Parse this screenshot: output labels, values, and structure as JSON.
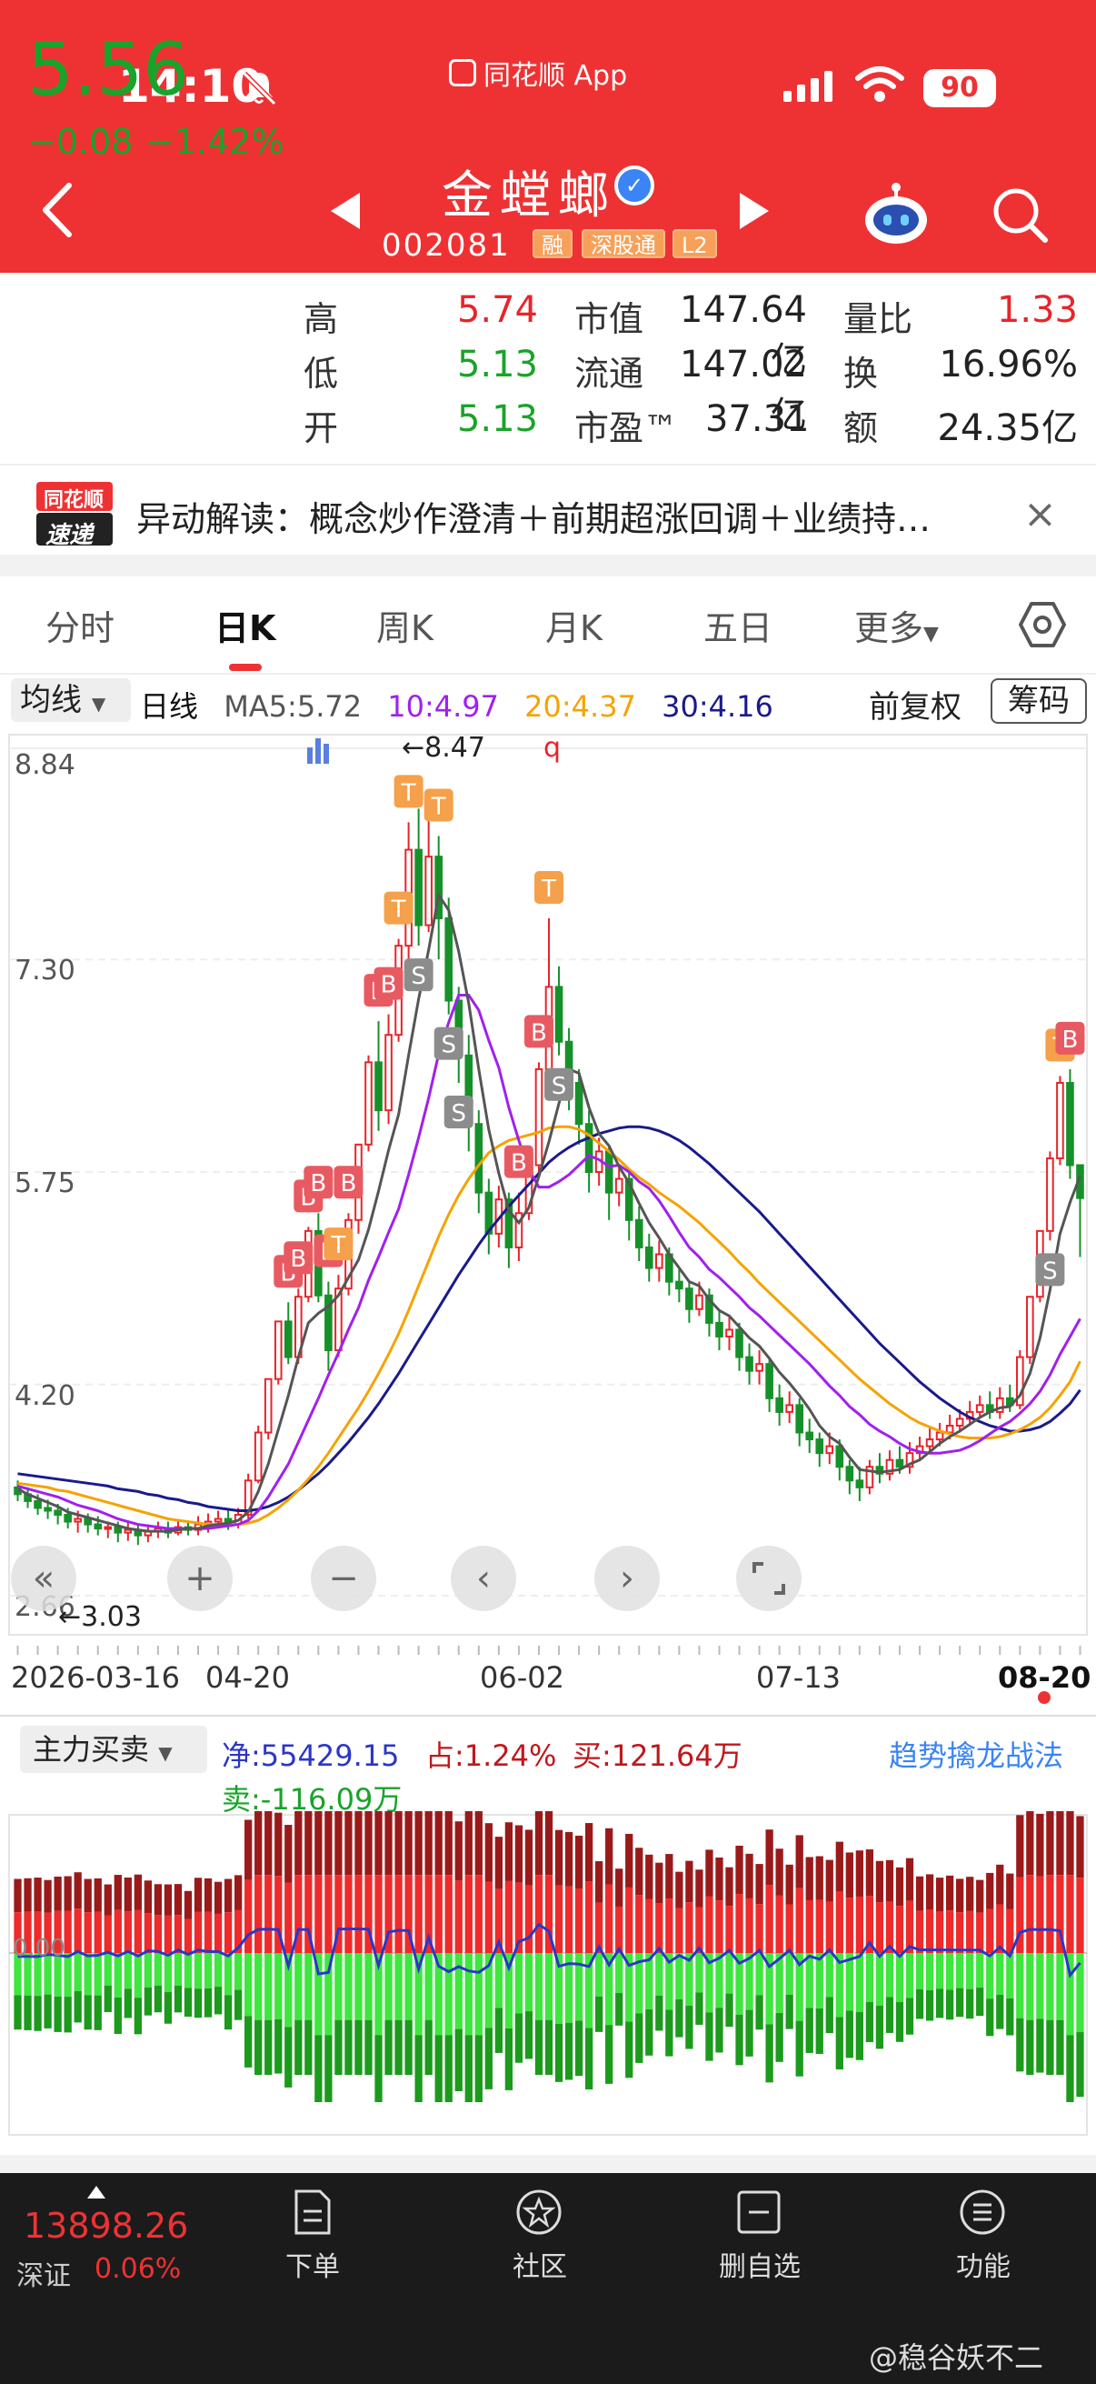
{
  "status": {
    "time": "14:10",
    "source_app": "同花顺 App",
    "battery": "90"
  },
  "stock": {
    "name": "金螳螂",
    "code": "002081",
    "tags": [
      "融",
      "深股通",
      "L2"
    ]
  },
  "quote": {
    "price": "5.56",
    "change": "−0.08",
    "change_pct": "−1.42%",
    "high_label": "高",
    "high": "5.74",
    "low_label": "低",
    "low": "5.13",
    "open_label": "开",
    "open": "5.13",
    "mktcap_label": "市值",
    "mktcap": "147.64亿",
    "float_label": "流通",
    "float": "147.02亿",
    "pe_label": "市盈™",
    "pe": "37.31",
    "vol_ratio_label": "量比",
    "vol_ratio": "1.33",
    "turnover_label": "换",
    "turnover": "16.96%",
    "amount_label": "额",
    "amount": "24.35亿"
  },
  "news": {
    "logo_line1": "同花顺",
    "logo_line2": "速递",
    "text": "异动解读：概念炒作澄清＋前期超涨回调＋业绩持…",
    "close": "×"
  },
  "tabs": [
    "分时",
    "日K",
    "周K",
    "月K",
    "五日",
    "更多"
  ],
  "ma": {
    "select": "均线",
    "period": "日线",
    "ma5": "MA5:5.72",
    "ma10": "10:4.97",
    "ma20": "20:4.37",
    "ma30": "30:4.16",
    "adjust": "前复权",
    "chips": "筹码",
    "colors": {
      "ma5": "#555555",
      "ma10": "#a020f0",
      "ma20": "#f5a300",
      "ma30": "#1a1a8c"
    }
  },
  "chart_data": {
    "type": "candlestick",
    "y_ticks": [
      "8.84",
      "7.30",
      "5.75",
      "4.20",
      "2.66"
    ],
    "ylim": [
      2.66,
      8.84
    ],
    "x_ticks": [
      "2026-03-16",
      "04-20",
      "06-02",
      "07-13",
      "08-20"
    ],
    "annotations": {
      "high_marker": "←8.47",
      "low_marker": "←3.03"
    },
    "marker_labels": {
      "buy": "B",
      "sell": "S",
      "t": "T",
      "q": "q"
    },
    "candles": [
      [
        3.45,
        3.4,
        3.5,
        3.35
      ],
      [
        3.4,
        3.35,
        3.45,
        3.3
      ],
      [
        3.35,
        3.3,
        3.4,
        3.25
      ],
      [
        3.3,
        3.28,
        3.36,
        3.22
      ],
      [
        3.28,
        3.25,
        3.33,
        3.18
      ],
      [
        3.25,
        3.2,
        3.3,
        3.15
      ],
      [
        3.2,
        3.22,
        3.28,
        3.12
      ],
      [
        3.22,
        3.18,
        3.26,
        3.12
      ],
      [
        3.18,
        3.15,
        3.24,
        3.1
      ],
      [
        3.15,
        3.16,
        3.2,
        3.08
      ],
      [
        3.16,
        3.12,
        3.2,
        3.05
      ],
      [
        3.12,
        3.14,
        3.2,
        3.06
      ],
      [
        3.14,
        3.1,
        3.18,
        3.03
      ],
      [
        3.1,
        3.13,
        3.18,
        3.05
      ],
      [
        3.13,
        3.15,
        3.2,
        3.08
      ],
      [
        3.15,
        3.12,
        3.2,
        3.08
      ],
      [
        3.12,
        3.16,
        3.22,
        3.1
      ],
      [
        3.16,
        3.14,
        3.2,
        3.1
      ],
      [
        3.14,
        3.18,
        3.24,
        3.1
      ],
      [
        3.18,
        3.2,
        3.26,
        3.12
      ],
      [
        3.2,
        3.22,
        3.28,
        3.15
      ],
      [
        3.22,
        3.18,
        3.28,
        3.14
      ],
      [
        3.18,
        3.25,
        3.3,
        3.15
      ],
      [
        3.25,
        3.5,
        3.55,
        3.22
      ],
      [
        3.5,
        3.85,
        3.9,
        3.48
      ],
      [
        3.85,
        4.24,
        4.24,
        3.8
      ],
      [
        4.24,
        4.66,
        4.66,
        4.2
      ],
      [
        4.66,
        4.4,
        4.8,
        4.35
      ],
      [
        4.4,
        4.84,
        4.9,
        4.35
      ],
      [
        4.84,
        5.32,
        5.35,
        4.8
      ],
      [
        5.32,
        4.85,
        5.45,
        4.8
      ],
      [
        4.85,
        4.45,
        4.95,
        4.3
      ],
      [
        4.45,
        4.9,
        5.0,
        4.4
      ],
      [
        4.9,
        5.4,
        5.45,
        4.85
      ],
      [
        5.4,
        5.95,
        5.95,
        5.3
      ],
      [
        5.95,
        6.55,
        6.6,
        5.9
      ],
      [
        6.55,
        6.2,
        6.85,
        6.05
      ],
      [
        6.2,
        6.75,
        6.9,
        6.1
      ],
      [
        6.75,
        7.4,
        7.45,
        6.7
      ],
      [
        7.4,
        8.1,
        8.3,
        7.3
      ],
      [
        8.1,
        7.55,
        8.4,
        7.4
      ],
      [
        7.55,
        8.05,
        8.47,
        7.5
      ],
      [
        8.05,
        7.6,
        8.2,
        7.3
      ],
      [
        7.6,
        7.0,
        7.75,
        6.9
      ],
      [
        7.0,
        6.6,
        7.1,
        6.4
      ],
      [
        6.6,
        6.1,
        6.75,
        5.9
      ],
      [
        6.1,
        5.6,
        6.2,
        5.45
      ],
      [
        5.6,
        5.3,
        5.7,
        5.15
      ],
      [
        5.3,
        5.55,
        5.65,
        5.2
      ],
      [
        5.55,
        5.2,
        5.6,
        5.05
      ],
      [
        5.2,
        5.45,
        5.6,
        5.1
      ],
      [
        5.45,
        5.8,
        5.9,
        5.4
      ],
      [
        5.8,
        6.5,
        6.55,
        5.75
      ],
      [
        6.5,
        7.1,
        7.6,
        6.4
      ],
      [
        7.1,
        6.7,
        7.25,
        6.6
      ],
      [
        6.7,
        6.4,
        6.8,
        6.2
      ],
      [
        6.4,
        6.1,
        6.5,
        5.95
      ],
      [
        6.1,
        5.75,
        6.2,
        5.6
      ],
      [
        5.75,
        5.9,
        6.0,
        5.65
      ],
      [
        5.9,
        5.6,
        5.95,
        5.4
      ],
      [
        5.6,
        5.7,
        5.8,
        5.5
      ],
      [
        5.7,
        5.4,
        5.75,
        5.25
      ],
      [
        5.4,
        5.2,
        5.5,
        5.1
      ],
      [
        5.2,
        5.05,
        5.3,
        4.95
      ],
      [
        5.05,
        5.15,
        5.25,
        4.95
      ],
      [
        5.15,
        4.95,
        5.2,
        4.85
      ],
      [
        4.95,
        4.9,
        5.05,
        4.8
      ],
      [
        4.9,
        4.75,
        4.95,
        4.65
      ],
      [
        4.75,
        4.85,
        4.95,
        4.7
      ],
      [
        4.85,
        4.65,
        4.9,
        4.55
      ],
      [
        4.65,
        4.55,
        4.75,
        4.45
      ],
      [
        4.55,
        4.6,
        4.7,
        4.45
      ],
      [
        4.6,
        4.4,
        4.65,
        4.3
      ],
      [
        4.4,
        4.3,
        4.5,
        4.2
      ],
      [
        4.3,
        4.35,
        4.45,
        4.2
      ],
      [
        4.35,
        4.1,
        4.4,
        4.0
      ],
      [
        4.1,
        4.0,
        4.2,
        3.9
      ],
      [
        4.0,
        4.05,
        4.15,
        3.92
      ],
      [
        4.05,
        3.85,
        4.1,
        3.75
      ],
      [
        3.85,
        3.8,
        3.95,
        3.7
      ],
      [
        3.8,
        3.7,
        3.85,
        3.6
      ],
      [
        3.7,
        3.75,
        3.85,
        3.62
      ],
      [
        3.75,
        3.6,
        3.8,
        3.5
      ],
      [
        3.6,
        3.5,
        3.65,
        3.4
      ],
      [
        3.5,
        3.45,
        3.6,
        3.35
      ],
      [
        3.45,
        3.6,
        3.65,
        3.4
      ],
      [
        3.6,
        3.55,
        3.7,
        3.48
      ],
      [
        3.55,
        3.65,
        3.72,
        3.5
      ],
      [
        3.65,
        3.6,
        3.75,
        3.55
      ],
      [
        3.6,
        3.7,
        3.78,
        3.55
      ],
      [
        3.7,
        3.75,
        3.82,
        3.65
      ],
      [
        3.75,
        3.8,
        3.88,
        3.7
      ],
      [
        3.8,
        3.85,
        3.92,
        3.75
      ],
      [
        3.85,
        3.9,
        3.98,
        3.8
      ],
      [
        3.9,
        3.95,
        4.02,
        3.85
      ],
      [
        3.95,
        4.0,
        4.08,
        3.9
      ],
      [
        4.0,
        4.05,
        4.12,
        3.95
      ],
      [
        4.05,
        4.0,
        4.15,
        3.95
      ],
      [
        4.0,
        4.1,
        4.18,
        3.95
      ],
      [
        4.1,
        4.05,
        4.2,
        4.0
      ],
      [
        4.05,
        4.4,
        4.45,
        4.02
      ],
      [
        4.4,
        4.84,
        4.84,
        4.35
      ],
      [
        4.84,
        5.32,
        5.32,
        4.8
      ],
      [
        5.32,
        5.85,
        5.9,
        5.25
      ],
      [
        5.85,
        6.4,
        6.45,
        5.8
      ],
      [
        6.4,
        5.8,
        6.5,
        5.7
      ],
      [
        5.8,
        5.56,
        5.74,
        5.13
      ]
    ],
    "ma5": [
      3.44,
      3.4,
      3.37,
      3.34,
      3.31,
      3.27,
      3.25,
      3.23,
      3.21,
      3.19,
      3.17,
      3.15,
      3.14,
      3.13,
      3.13,
      3.13,
      3.14,
      3.15,
      3.15,
      3.17,
      3.18,
      3.19,
      3.21,
      3.27,
      3.42,
      3.62,
      3.87,
      4.12,
      4.4,
      4.65,
      4.72,
      4.77,
      4.85,
      4.98,
      5.11,
      5.33,
      5.61,
      5.91,
      6.17,
      6.6,
      7.01,
      7.37,
      7.77,
      7.66,
      7.36,
      6.98,
      6.5,
      6.06,
      5.74,
      5.47,
      5.38,
      5.49,
      5.72,
      5.97,
      6.25,
      6.5,
      6.47,
      6.22,
      6.03,
      5.94,
      5.79,
      5.67,
      5.52,
      5.38,
      5.27,
      5.15,
      5.05,
      4.95,
      4.92,
      4.82,
      4.74,
      4.7,
      4.62,
      4.54,
      4.48,
      4.39,
      4.29,
      4.21,
      4.12,
      4.02,
      3.9,
      3.82,
      3.77,
      3.67,
      3.58,
      3.57,
      3.56,
      3.57,
      3.58,
      3.62,
      3.65,
      3.71,
      3.77,
      3.82,
      3.86,
      3.91,
      3.96,
      4.0,
      4.03,
      4.04,
      4.12,
      4.28,
      4.54,
      4.89,
      5.3,
      5.53,
      5.72
    ],
    "ma10": [
      3.46,
      3.44,
      3.42,
      3.4,
      3.38,
      3.35,
      3.32,
      3.3,
      3.28,
      3.25,
      3.22,
      3.2,
      3.18,
      3.17,
      3.16,
      3.15,
      3.15,
      3.15,
      3.15,
      3.15,
      3.16,
      3.17,
      3.18,
      3.21,
      3.28,
      3.38,
      3.5,
      3.62,
      3.78,
      3.94,
      4.1,
      4.27,
      4.43,
      4.6,
      4.76,
      4.96,
      5.13,
      5.31,
      5.48,
      5.73,
      6.0,
      6.29,
      6.61,
      6.84,
      7.04,
      7.04,
      6.93,
      6.71,
      6.51,
      6.22,
      5.98,
      5.77,
      5.64,
      5.64,
      5.68,
      5.73,
      5.8,
      5.87,
      5.84,
      5.79,
      5.8,
      5.75,
      5.68,
      5.63,
      5.54,
      5.43,
      5.31,
      5.2,
      5.13,
      5.04,
      4.98,
      4.91,
      4.84,
      4.76,
      4.7,
      4.63,
      4.56,
      4.49,
      4.42,
      4.35,
      4.27,
      4.19,
      4.12,
      4.04,
      3.98,
      3.91,
      3.86,
      3.82,
      3.77,
      3.73,
      3.71,
      3.7,
      3.7,
      3.71,
      3.72,
      3.75,
      3.79,
      3.84,
      3.89,
      3.93,
      3.99,
      4.06,
      4.15,
      4.27,
      4.42,
      4.55,
      4.68
    ],
    "ma20": [
      3.48,
      3.47,
      3.46,
      3.45,
      3.43,
      3.42,
      3.4,
      3.38,
      3.36,
      3.34,
      3.32,
      3.3,
      3.28,
      3.26,
      3.24,
      3.22,
      3.21,
      3.2,
      3.19,
      3.18,
      3.18,
      3.18,
      3.18,
      3.19,
      3.21,
      3.25,
      3.3,
      3.36,
      3.43,
      3.51,
      3.6,
      3.7,
      3.81,
      3.92,
      4.03,
      4.15,
      4.28,
      4.42,
      4.57,
      4.74,
      4.92,
      5.1,
      5.28,
      5.44,
      5.58,
      5.7,
      5.8,
      5.89,
      5.94,
      5.98,
      6.0,
      6.02,
      6.04,
      6.07,
      6.08,
      6.08,
      6.06,
      6.02,
      5.96,
      5.9,
      5.84,
      5.77,
      5.71,
      5.66,
      5.6,
      5.55,
      5.5,
      5.44,
      5.38,
      5.31,
      5.24,
      5.17,
      5.09,
      5.02,
      4.94,
      4.87,
      4.8,
      4.73,
      4.66,
      4.59,
      4.52,
      4.45,
      4.38,
      4.31,
      4.24,
      4.18,
      4.12,
      4.06,
      4.01,
      3.96,
      3.92,
      3.89,
      3.86,
      3.84,
      3.82,
      3.81,
      3.81,
      3.81,
      3.82,
      3.84,
      3.87,
      3.91,
      3.96,
      4.03,
      4.12,
      4.22,
      4.37
    ],
    "ma30": [
      3.55,
      3.54,
      3.53,
      3.52,
      3.51,
      3.5,
      3.49,
      3.48,
      3.47,
      3.46,
      3.44,
      3.43,
      3.42,
      3.4,
      3.39,
      3.37,
      3.36,
      3.34,
      3.33,
      3.31,
      3.3,
      3.29,
      3.28,
      3.28,
      3.29,
      3.31,
      3.34,
      3.38,
      3.43,
      3.49,
      3.55,
      3.62,
      3.7,
      3.78,
      3.87,
      3.96,
      4.06,
      4.17,
      4.28,
      4.4,
      4.52,
      4.64,
      4.76,
      4.88,
      5.0,
      5.11,
      5.22,
      5.32,
      5.41,
      5.5,
      5.58,
      5.66,
      5.74,
      5.82,
      5.88,
      5.93,
      5.97,
      6.0,
      6.03,
      6.05,
      6.07,
      6.08,
      6.08,
      6.07,
      6.05,
      6.02,
      5.98,
      5.93,
      5.87,
      5.81,
      5.74,
      5.67,
      5.6,
      5.53,
      5.46,
      5.38,
      5.3,
      5.22,
      5.14,
      5.06,
      4.98,
      4.9,
      4.82,
      4.74,
      4.66,
      4.58,
      4.5,
      4.43,
      4.36,
      4.29,
      4.22,
      4.16,
      4.1,
      4.05,
      4.0,
      3.96,
      3.93,
      3.9,
      3.88,
      3.86,
      3.86,
      3.87,
      3.89,
      3.93,
      3.99,
      4.06,
      4.16
    ]
  },
  "chart_controls": {
    "collapse": "«",
    "zoom_in": "+",
    "zoom_out": "−",
    "prev": "‹",
    "next": "›"
  },
  "flow": {
    "select": "主力买卖",
    "net": "净:55429.15",
    "share": "占:1.24%",
    "buy": "买:121.64万",
    "sell": "卖:-116.09万",
    "strategy": "趋势擒龙战法",
    "zero": "0.00",
    "colors": {
      "buy": "#ee2a2a",
      "buy_dark": "#9a1a1a",
      "sell": "#3ee63e",
      "sell_dark": "#1c9a1c",
      "net": "#2b36c9"
    }
  },
  "bottom_nav": {
    "index_value": "13898.26",
    "index_name": "深证",
    "index_pct": "0.06%",
    "items": [
      "下单",
      "社区",
      "删自选",
      "功能"
    ]
  },
  "watermark": "@稳谷妖不二"
}
